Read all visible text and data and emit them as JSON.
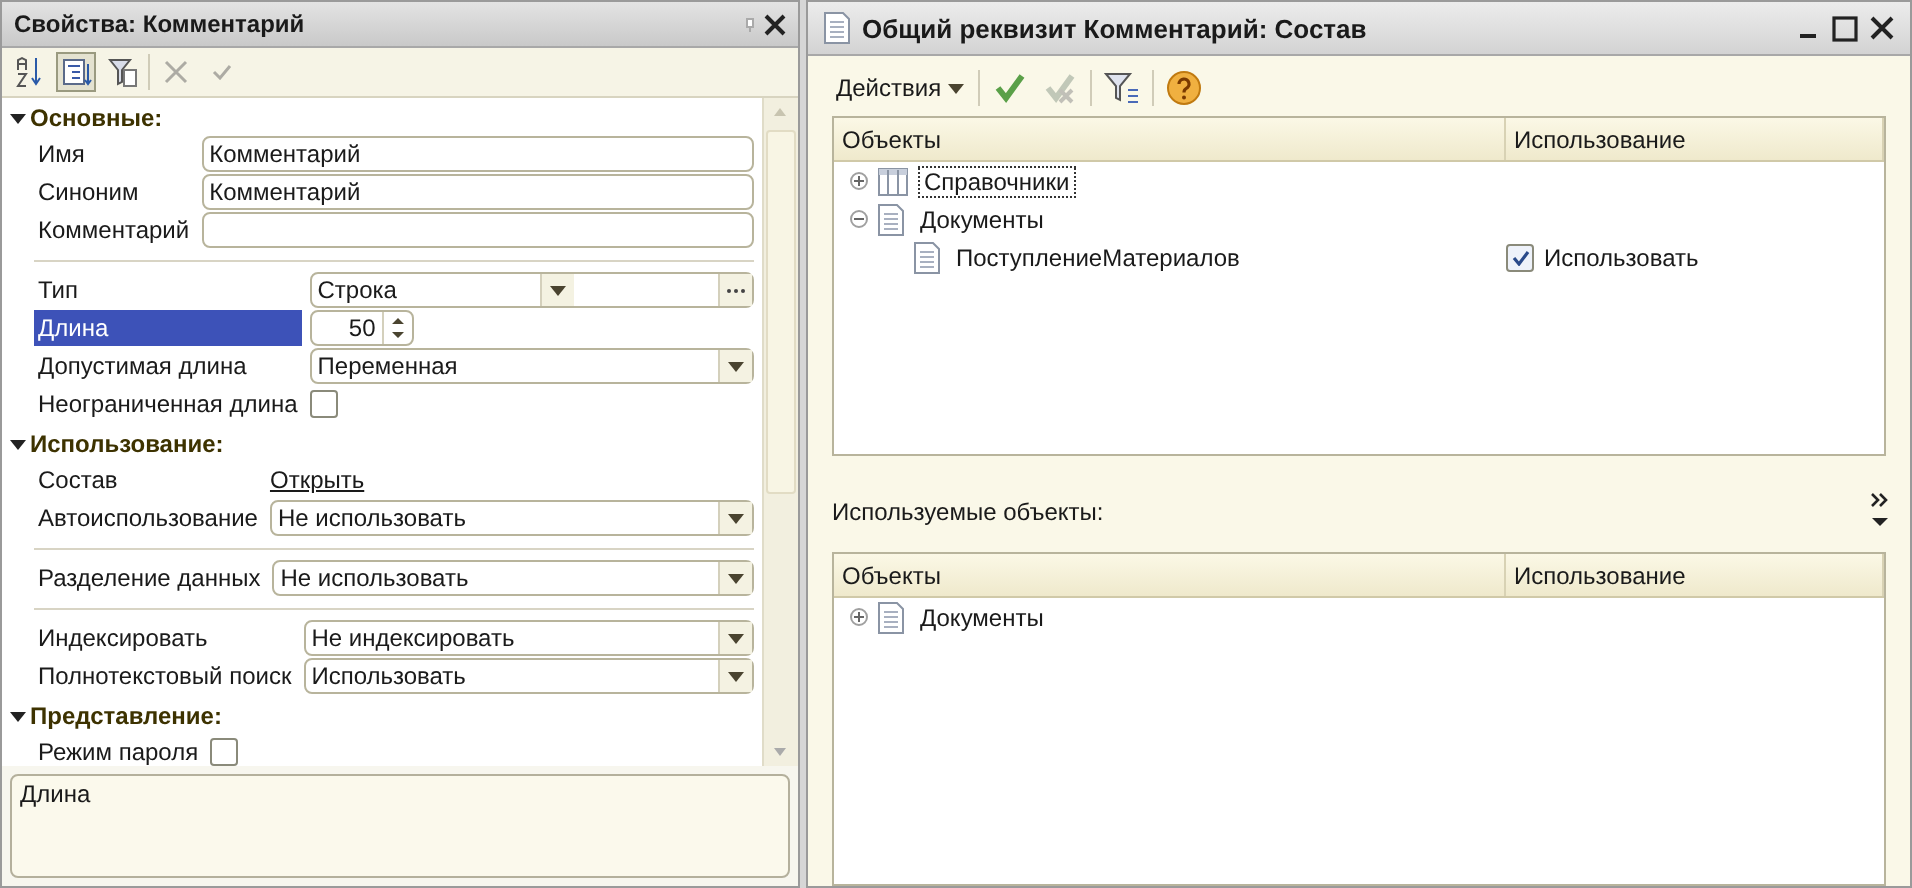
{
  "properties_panel": {
    "title": "Свойства: Комментарий",
    "toolbar": [
      {
        "kind": "sort",
        "selected": false,
        "disabled": false
      },
      {
        "kind": "categories",
        "selected": true,
        "disabled": false
      },
      {
        "kind": "filter",
        "selected": false,
        "disabled": false
      },
      {
        "kind": "delete",
        "selected": false,
        "disabled": true
      },
      {
        "kind": "confirm",
        "selected": false,
        "disabled": true
      }
    ],
    "sections": [
      {
        "title": "Основные:",
        "expanded": true,
        "groups": [
          [
            {
              "label": "Имя",
              "kind": "text",
              "value": "Комментарий",
              "selected": false
            },
            {
              "label": "Синоним",
              "kind": "text",
              "value": "Комментарий",
              "selected": false
            },
            {
              "label": "Комментарий",
              "kind": "text",
              "selected": false
            }
          ],
          [
            {
              "label": "Тип",
              "kind": "choice",
              "value": "Строка",
              "selected": false
            },
            {
              "label": "Длина",
              "kind": "number",
              "value": "50",
              "selected": true
            },
            {
              "label": "Допустимая длина",
              "kind": "combo",
              "value": "Переменная",
              "selected": false
            },
            {
              "label": "Неограниченная длина",
              "kind": "checkbox",
              "checked": false,
              "selected": false
            }
          ]
        ]
      },
      {
        "title": "Использование:",
        "expanded": true,
        "groups": [
          [
            {
              "label": "Состав",
              "kind": "link",
              "value": "Открыть",
              "selected": false
            },
            {
              "label": "Автоиспользование",
              "kind": "combo",
              "value": "Не использовать",
              "selected": false
            }
          ],
          [
            {
              "label": "Разделение данных",
              "kind": "combo",
              "value": "Не использовать",
              "selected": false
            }
          ],
          [
            {
              "label": "Индексировать",
              "kind": "combo",
              "value": "Не индексировать",
              "selected": false
            },
            {
              "label": "Полнотекстовый поиск",
              "kind": "combo",
              "value": "Использовать",
              "selected": false
            }
          ]
        ]
      },
      {
        "title": "Представление:",
        "expanded": true,
        "groups": [
          [
            {
              "label": "Режим пароля",
              "kind": "checkbox",
              "checked": false,
              "selected": false
            }
          ]
        ]
      }
    ],
    "description": "Длина"
  },
  "composition_window": {
    "title": "Общий реквизит Комментарий: Состав",
    "toolbar": [
      {
        "kind": "menu",
        "label": "Действия",
        "disabled": false
      },
      {
        "kind": "check",
        "disabled": false
      },
      {
        "kind": "check-all",
        "disabled": true
      },
      {
        "kind": "filter",
        "disabled": false
      },
      {
        "kind": "help",
        "disabled": false
      }
    ],
    "table": {
      "columns": [
        "Объекты",
        "Использование"
      ],
      "rows": [
        {
          "label": "Справочники",
          "kind": "catalog",
          "expanded": false,
          "focused": true
        },
        {
          "label": "Документы",
          "kind": "document",
          "expanded": true,
          "focused": false,
          "children": [
            {
              "label": "ПоступлениеМатериалов",
              "kind": "document",
              "focused": false,
              "usage": {
                "checked": true,
                "label": "Использовать"
              }
            }
          ]
        }
      ]
    },
    "used_objects_label": "Используемые объекты:",
    "used_table": {
      "columns": [
        "Объекты",
        "Использование"
      ],
      "rows": [
        {
          "label": "Документы",
          "kind": "document",
          "expanded": false,
          "focused": false
        }
      ]
    }
  }
}
